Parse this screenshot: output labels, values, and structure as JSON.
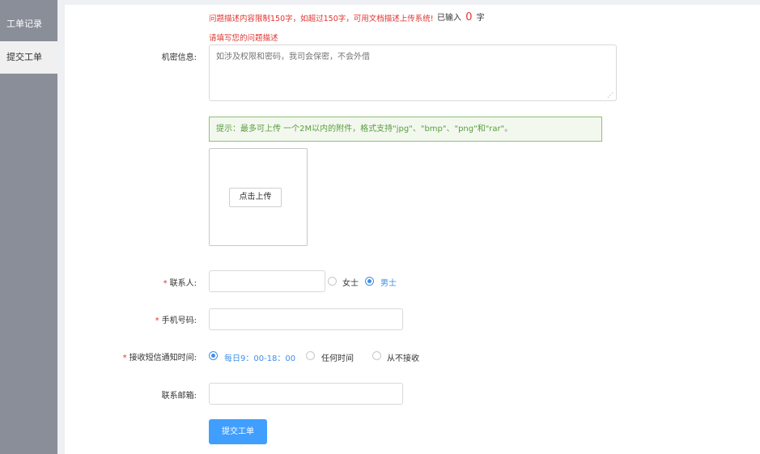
{
  "sidebar": {
    "items": [
      {
        "label": "工单记录"
      },
      {
        "label": "提交工单"
      }
    ]
  },
  "form": {
    "desc_limit_note": "问题描述内容限制150字，如超过150字，可用文档描述上传系统!",
    "count_prefix": "已输入",
    "count_value": "0",
    "count_suffix": "字",
    "desc_error": "请填写您的问题描述",
    "secret_label": "机密信息:",
    "secret_placeholder": "如涉及权限和密码，我司会保密，不会外借",
    "upload_tip": "提示：最多可上传 一个2M以内的附件，格式支持\"jpg\"、\"bmp\"、\"png\"和\"rar\"。",
    "upload_button": "点击上传",
    "contact_label": "联系人:",
    "gender_options": [
      "女士",
      "男士"
    ],
    "gender_selected": "男士",
    "phone_label": "手机号码:",
    "sms_time_label": "接收短信通知时间:",
    "sms_options": [
      "每日9：00-18：00",
      "任何时间",
      "从不接收"
    ],
    "sms_selected": "每日9：00-18：00",
    "email_label": "联系邮箱:",
    "required_mark": "*",
    "submit_button": "提交工单"
  },
  "colors": {
    "sidebar_bg": "#8a8e99",
    "accent": "#409eff",
    "error": "#e0342f",
    "tip_green": "#5a9e40"
  }
}
